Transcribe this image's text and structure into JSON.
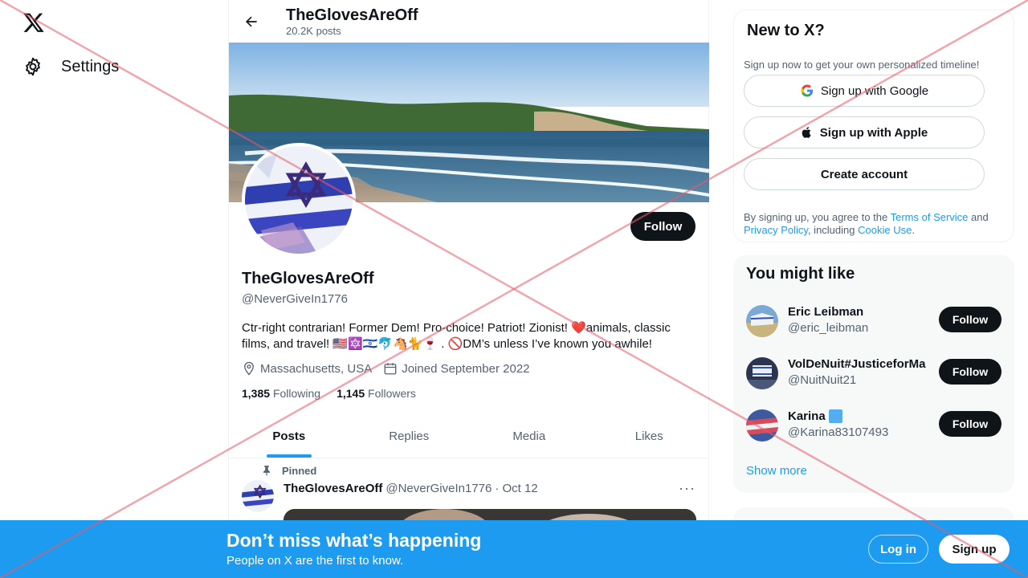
{
  "nav": {
    "settings_label": "Settings"
  },
  "profile": {
    "header_name": "TheGlovesAreOff",
    "post_count": "20.2K posts",
    "name": "TheGlovesAreOff",
    "handle": "@NeverGiveIn1776",
    "follow_label": "Follow",
    "bio": "Ctr-right contrarian! Former Dem! Pro-choice! Patriot! Zionist! ❤️animals, classic films, and travel! 🇺🇸🔯🇮🇱🐬🐴🐈🍷 . 🚫DM’s unless I’ve known you awhile!",
    "location": "Massachusetts, USA",
    "joined": "Joined September 2022",
    "following_count": "1,385",
    "following_label": "Following",
    "followers_count": "1,145",
    "followers_label": "Followers"
  },
  "tabs": [
    "Posts",
    "Replies",
    "Media",
    "Likes"
  ],
  "pinned_tweet": {
    "pinned_label": "Pinned",
    "author": "TheGlovesAreOff",
    "handle": "@NeverGiveIn1776",
    "date": "· Oct 12",
    "more": "···"
  },
  "signup_card": {
    "title": "New to X?",
    "subtitle": "Sign up now to get your own personalized timeline!",
    "google_label": "Sign up with Google",
    "apple_label": "Sign up with Apple",
    "create_label": "Create account",
    "terms_prefix": "By signing up, you agree to the ",
    "terms_link": "Terms of Service",
    "terms_and": " and ",
    "privacy_link": "Privacy Policy",
    "terms_mid": ", including ",
    "cookie_link": "Cookie Use",
    "terms_end": "."
  },
  "suggestions": {
    "title": "You might like",
    "items": [
      {
        "name": "Eric Leibman",
        "handle": "@eric_leibman",
        "follow_label": "Follow"
      },
      {
        "name": "VolDeNuit#JusticeforMa",
        "handle": "@NuitNuit21",
        "follow_label": "Follow"
      },
      {
        "name": "Karina",
        "handle": "@Karina83107493",
        "follow_label": "Follow"
      }
    ],
    "show_more": "Show more"
  },
  "bottom_bar": {
    "title": "Don’t miss what’s happening",
    "subtitle": "People on X are the first to know.",
    "login_label": "Log in",
    "signup_label": "Sign up"
  },
  "colors": {
    "accent": "#1d9bf0",
    "dark": "#0f1419",
    "muted": "#536471",
    "overlay_cross": "#e85a6a"
  }
}
